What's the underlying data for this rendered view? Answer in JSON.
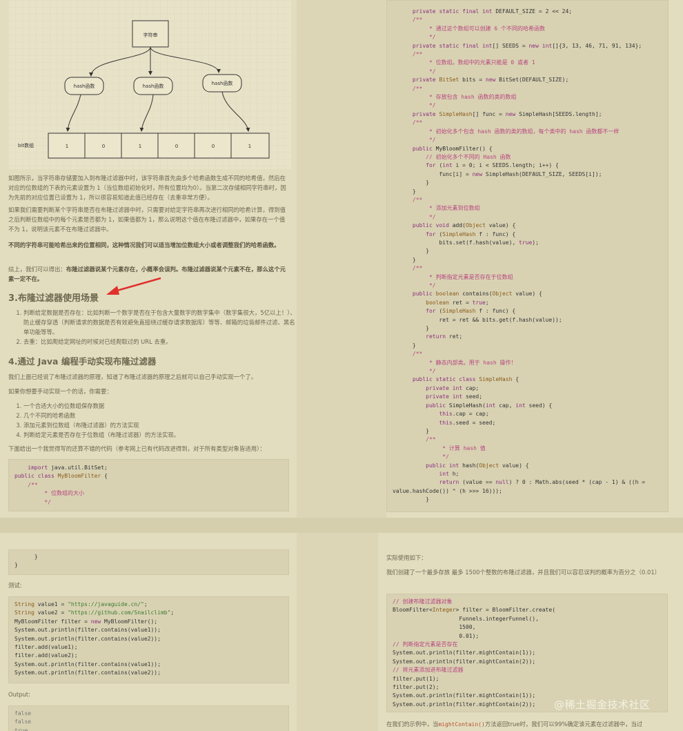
{
  "diagram": {
    "top_node": "字符串",
    "hash_nodes": [
      "hash函数",
      "hash函数",
      "hash函数"
    ],
    "row_label": "bit数组",
    "bits": [
      "1",
      "0",
      "1",
      "0",
      "0",
      "1"
    ]
  },
  "left": {
    "para1": "如图所示，当字符串存储要加入到布隆过滤器中时，该字符串首先由多个哈希函数生成不同的哈希值，然后在对应的位数组的下表的元素设置为 1（当位数组初始化时，所有位置均为0）。当第二次存储相同字符串时，因为先前的对应位置已设置为 1，所以很容易知道此值已经存在（去重非常方便）。",
    "para2": "如果我们需要判断某个字符串是否在布隆过滤器中时，只需要对给定字符串再次进行相同的哈希计算，得到值之后判断位数组中的每个元素是否都为 1，如果值都为 1，那么说明这个值在布隆过滤器中，如果存在一个值不为 1，说明该元素不在布隆过滤器中。",
    "para3": "不同的字符串可能哈希出来的位置相同，这种情况我们可以适当增加位数组大小或者调整我们的哈希函数。",
    "para4_prefix": "综上，我们可以得出：",
    "para4_bold": "布隆过滤器说某个元素存在，小概率会误判。布隆过滤器说某个元素不在，那么这个元素一定不在。",
    "h3": "3.布隆过滤器使用场景",
    "scenarios": [
      "判断给定数据是否存在：比如判断一个数字是否在于包含大量数字的数字集中（数字集很大，5亿以上！）、 防止缓存穿透（判断请求的数据是否有效避免直接绕过缓存请求数据库）等等、邮箱的垃圾邮件过滤、黑名单功能等等。",
      "去重：比如爬给定网址的时候对已经爬取过的 URL 去重。"
    ],
    "h4": "4.通过 Java 编程手动实现布隆过滤器",
    "para5": "我们上面已经说了布隆过滤器的原理，知道了布隆过滤器的原理之后就可以自己手动实现一个了。",
    "para6": "如果你想要手动实现一个的话，你需要：",
    "needs": [
      "一个合适大小的位数组保存数据",
      "几个不同的哈希函数",
      "添加元素到位数组（布隆过滤器）的方法实现",
      "判断给定元素是否存在于位数组（布隆过滤器）的方法实现。"
    ],
    "para7": "下面给出一个我觉得写的还算不错的代码（参考网上已有代码改进得到，对于所有类型对象皆适用）："
  },
  "bottom_left": {
    "test_label": "测试:",
    "output_label": "Output:",
    "output_lines": [
      "false",
      "false",
      "true"
    ]
  },
  "bottom_right": {
    "usage_label": "实际使用如下：",
    "usage_desc": "我们创建了一个最多存放 最多 1500个整数的布隆过滤器，并且我们可以容忍误判的概率为百分之（0.01）",
    "footer_prefix": "在我们的示例中，当",
    "footer_code": "mightContain()",
    "footer_suffix": "方法返回true时，我们可以99%确定该元素在过滤器中，当过",
    "watermark": "@稀土掘金技术社区"
  }
}
